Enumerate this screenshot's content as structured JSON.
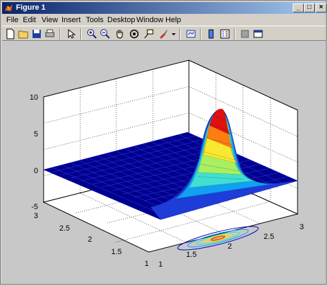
{
  "window": {
    "title": "Figure 1",
    "controls": [
      "_",
      "□",
      "×"
    ]
  },
  "menu": [
    {
      "label": "File"
    },
    {
      "label": "Edit"
    },
    {
      "label": "View"
    },
    {
      "label": "Insert"
    },
    {
      "label": "Tools"
    },
    {
      "label": "Desktop"
    },
    {
      "label": "Window"
    },
    {
      "label": "Help"
    }
  ],
  "toolbar": {
    "icons": [
      "new-figure-icon",
      "open-file-icon",
      "save-icon",
      "print-icon",
      "edit-plot-arrow-icon",
      "zoom-in-icon",
      "zoom-out-icon",
      "pan-hand-icon",
      "rotate-3d-icon",
      "data-cursor-icon",
      "brush-icon",
      "brush-dropdown-icon",
      "link-plot-icon",
      "insert-colorbar-icon",
      "insert-legend-icon",
      "hide-plot-tools-icon",
      "show-plot-tools-icon"
    ]
  },
  "axes": {
    "z_ticks": [
      "10",
      "5",
      "0",
      "-5"
    ],
    "y_ticks": [
      "3",
      "2.5",
      "2",
      "1.5",
      "1"
    ],
    "x_ticks": [
      "1",
      "1.5",
      "2",
      "2.5",
      "3"
    ]
  },
  "colors": {
    "surface_flat": "#00008f",
    "peak": "#ff0000",
    "axes_bg": "#ffffff",
    "figure_bg": "#c8c8c8"
  }
}
